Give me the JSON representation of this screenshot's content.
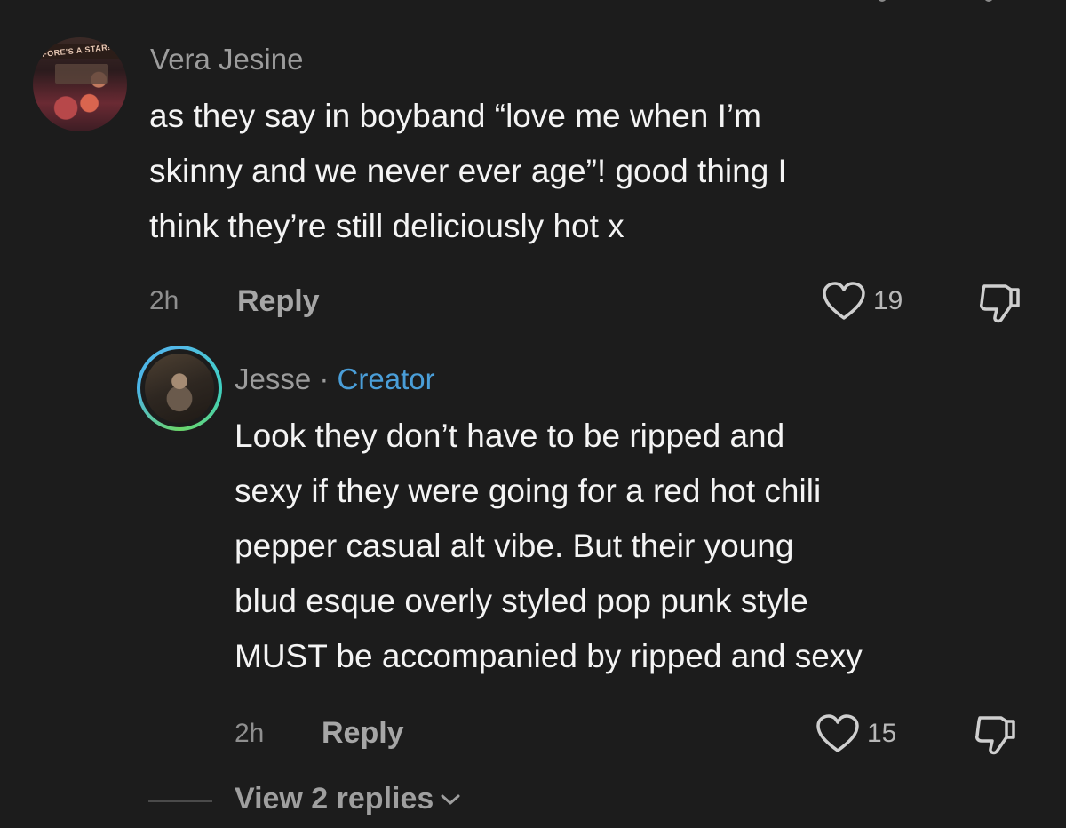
{
  "comments": [
    {
      "username": "Vera Jesine",
      "avatar_banner": "FORE'S A STAR!",
      "text_lines": [
        "as they say in boyband “love me when I’m",
        "skinny and we never ever age”! good thing I",
        "think they’re still deliciously hot x"
      ],
      "time": "2h",
      "reply_label": "Reply",
      "likes": "19"
    },
    {
      "username": "Jesse",
      "separator": " · ",
      "badge": "Creator",
      "text_lines": [
        "Look they don’t have to be ripped and",
        "sexy if they were going for a red hot chili",
        "pepper casual alt vibe. But their young",
        "blud esque overly styled pop punk style",
        "MUST be accompanied by ripped and sexy"
      ],
      "time": "2h",
      "reply_label": "Reply",
      "likes": "15"
    }
  ],
  "view_replies_label": "View 2 replies",
  "icons": {
    "like": "heart-icon",
    "dislike": "thumbs-down-icon",
    "expand": "chevron-down-icon"
  },
  "colors": {
    "background": "#1c1c1c",
    "creator_badge": "#4a9ed8",
    "avatar_ring": "#53b9e8"
  }
}
